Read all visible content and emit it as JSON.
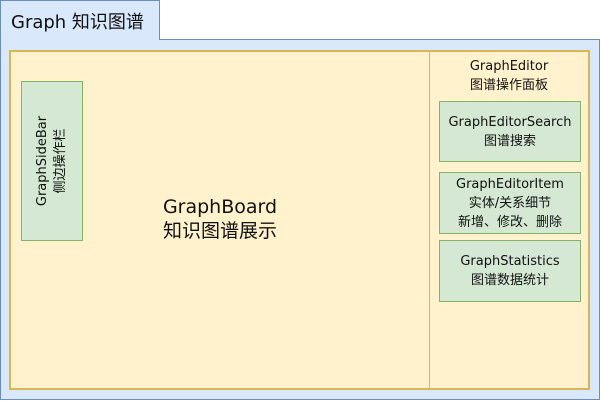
{
  "window": {
    "tab_title": "Graph 知识图谱"
  },
  "sidebar": {
    "title": "GraphSideBar",
    "subtitle": "侧边操作栏"
  },
  "board": {
    "title": "GraphBoard",
    "subtitle": "知识图谱展示"
  },
  "editor": {
    "title": "GraphEditor",
    "subtitle": "图谱操作面板",
    "search": {
      "title": "GraphEditorSearch",
      "subtitle": "图谱搜索"
    },
    "item": {
      "title": "GraphEditorItem",
      "line1": "实体/关系细节",
      "line2": "新增、修改、删除"
    },
    "stats": {
      "title": "GraphStatistics",
      "subtitle": "图谱数据统计"
    }
  },
  "colors": {
    "outer_fill": "#dae8fc",
    "outer_border": "#6c8ebf",
    "board_fill": "#fff2cc",
    "board_border": "#d6b656",
    "panel_fill": "#d5e8d4",
    "panel_border": "#82b366"
  }
}
